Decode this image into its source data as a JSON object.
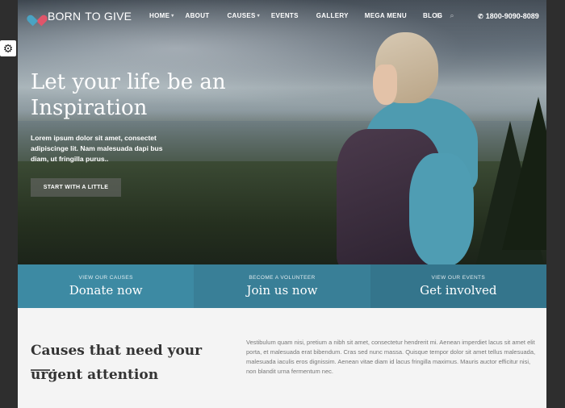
{
  "logo": {
    "part1": "BORN",
    "part2": "TO GIVE"
  },
  "nav": {
    "items": [
      {
        "label": "HOME",
        "has_caret": true
      },
      {
        "label": "ABOUT",
        "has_caret": false
      },
      {
        "label": "CAUSES",
        "has_caret": true
      },
      {
        "label": "EVENTS",
        "has_caret": false
      },
      {
        "label": "GALLERY",
        "has_caret": false
      },
      {
        "label": "MEGA MENU",
        "has_caret": false
      },
      {
        "label": "BLOG",
        "has_caret": false
      }
    ],
    "phone": "1800-9090-8089"
  },
  "hero": {
    "title": "Let your life be an Inspiration",
    "text": "Lorem ipsum dolor sit amet, consectet adipiscinge lit. Nam malesuada dapi bus diam, ut fringilla purus..",
    "button_label": "START WITH A LITTLE"
  },
  "ctas": [
    {
      "small": "VIEW OUR CAUSES",
      "big": "Donate now"
    },
    {
      "small": "BECOME A VOLUNTEER",
      "big": "Join us now"
    },
    {
      "small": "VIEW OUR EVENTS",
      "big": "Get involved"
    }
  ],
  "causes": {
    "title": "Causes that need your urgent attention",
    "text": "Vestibulum quam nisi, pretium a nibh sit amet, consectetur hendrerit mi. Aenean imperdiet lacus sit amet elit porta, et malesuada erat bibendum. Cras sed nunc massa. Quisque tempor dolor sit amet tellus malesuada, malesuada iaculis eros dignissim. Aenean vitae diam id lacus fringilla maximus. Mauris auctor efficitur nisi, non blandit urna fermentum nec."
  },
  "colors": {
    "cta1": "#3d8aa3",
    "cta2": "#397f97",
    "cta3": "#34758c",
    "accent_red": "#e0556a",
    "accent_blue": "#4aa3c3"
  },
  "icons": {
    "settings": "gear-icon",
    "search": "search-icon",
    "cart": "cart-icon",
    "phone": "phone-icon",
    "logo": "heart-logo-icon"
  }
}
